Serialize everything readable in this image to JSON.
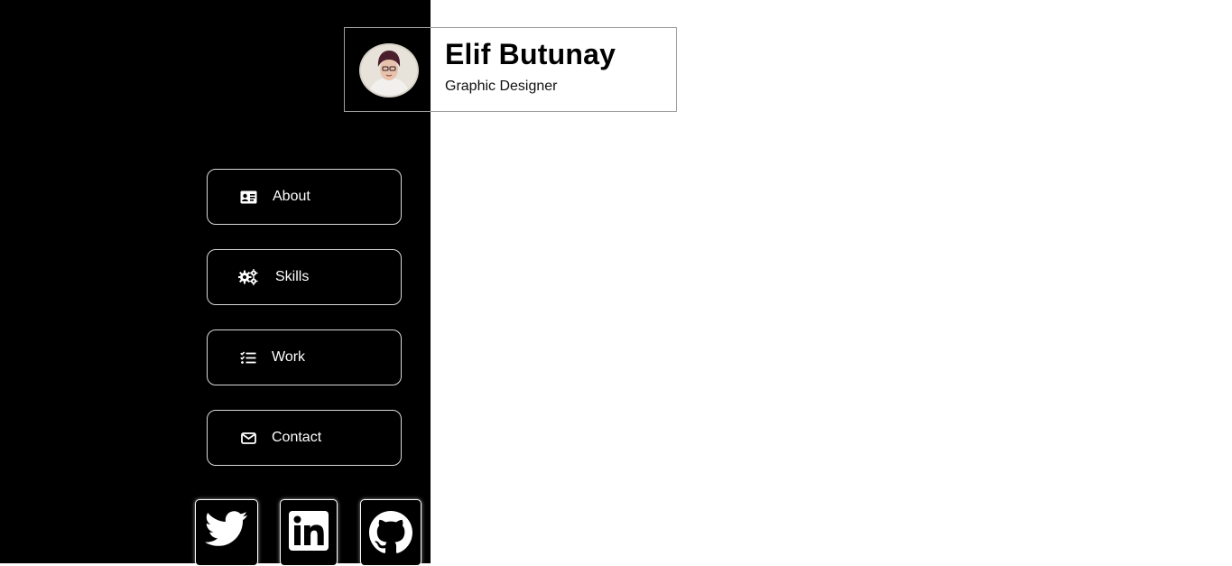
{
  "profile": {
    "name": "Elif Butunay",
    "role": "Graphic Designer",
    "avatar_icon": "portrait-photo"
  },
  "nav": [
    {
      "label": "About",
      "icon": "id-card-icon"
    },
    {
      "label": "Skills",
      "icon": "gears-icon"
    },
    {
      "label": "Work",
      "icon": "checklist-icon"
    },
    {
      "label": "Contact",
      "icon": "envelope-icon"
    }
  ],
  "social": [
    {
      "name": "twitter",
      "icon": "twitter-icon"
    },
    {
      "name": "linkedin",
      "icon": "linkedin-icon"
    },
    {
      "name": "github",
      "icon": "github-icon"
    }
  ],
  "colors": {
    "sidebar_bg": "#000000",
    "content_bg": "#ffffff",
    "button_border": "#d9d9d9",
    "text_light": "#ffffff"
  }
}
